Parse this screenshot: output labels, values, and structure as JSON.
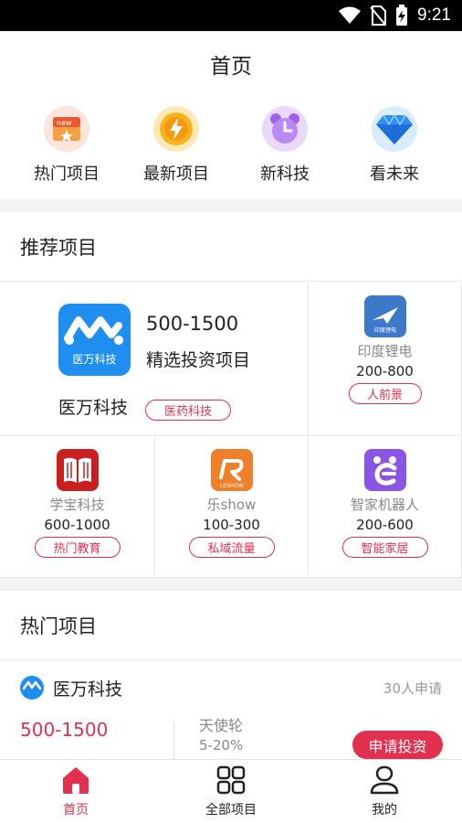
{
  "status_bar": {
    "time": "9:21",
    "icons": [
      "wifi-icon",
      "no-sim-icon",
      "battery-charging-icon"
    ]
  },
  "header": {
    "title": "首页"
  },
  "quick_nav": [
    {
      "label": "热门项目",
      "icon": "new-badge-icon"
    },
    {
      "label": "最新项目",
      "icon": "lightning-coin-icon"
    },
    {
      "label": "新科技",
      "icon": "alarm-clock-icon"
    },
    {
      "label": "看未来",
      "icon": "diamond-icon"
    }
  ],
  "recommended": {
    "title": "推荐项目",
    "featured": {
      "logo_text": "医万科技",
      "range": "500-1500",
      "subtitle": "精选投资项目",
      "name": "医万科技",
      "tag": "医药科技"
    },
    "items": [
      {
        "name": "印度锂电",
        "range": "200-800",
        "tag": "人前景",
        "logo_text": "印度锂电",
        "color": "#3d79c9"
      },
      {
        "name": "学宝科技",
        "range": "600-1000",
        "tag": "热门教育",
        "logo_text": "",
        "color": "#c9201f"
      },
      {
        "name": "乐show",
        "range": "100-300",
        "tag": "私域流量",
        "logo_text": "LESHOW",
        "color": "#f07f2a"
      },
      {
        "name": "智家机器人",
        "range": "200-600",
        "tag": "智能家居",
        "logo_text": "",
        "color": "#8a55e6"
      }
    ]
  },
  "hot": {
    "title": "热门项目",
    "card": {
      "name": "医万科技",
      "applicants": "30人申请",
      "range": "500-1500",
      "round": "天使轮",
      "equity": "5-20%",
      "apply_label": "申请投资"
    }
  },
  "bottom_nav": [
    {
      "label": "首页",
      "icon": "home-icon",
      "active": true
    },
    {
      "label": "全部项目",
      "icon": "grid-icon",
      "active": false
    },
    {
      "label": "我的",
      "icon": "user-icon",
      "active": false
    }
  ],
  "colors": {
    "accent": "#e2304f",
    "primary_blue": "#1e8ef0"
  }
}
